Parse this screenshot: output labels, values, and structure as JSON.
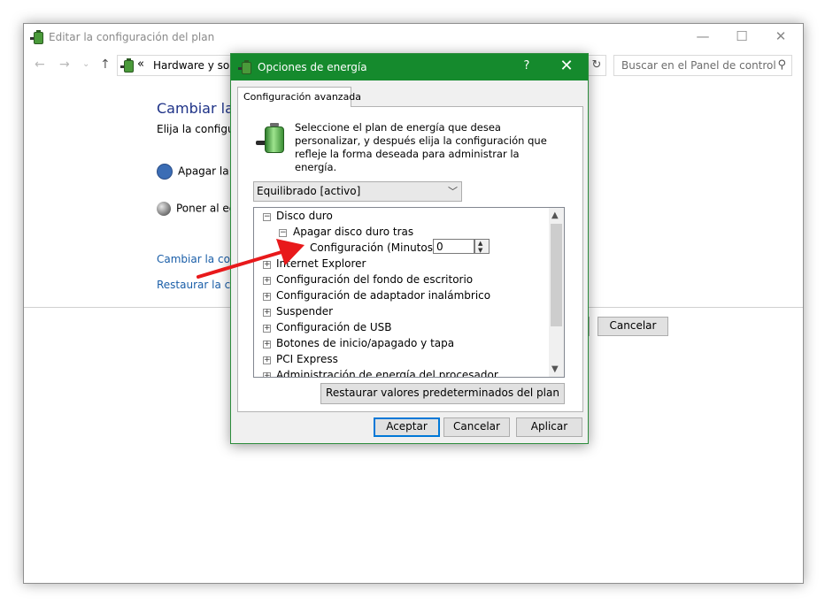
{
  "background_window": {
    "title": "Editar la configuración del plan",
    "controls": {
      "minimize": "—",
      "maximize": "☐",
      "close": "✕"
    },
    "nav": {
      "back": "←",
      "forward": "→",
      "recent": "⌄",
      "up": "↑"
    },
    "address": {
      "separator": "«",
      "path": "Hardware y sonido"
    },
    "refresh": "↻",
    "search_placeholder": "Buscar en el Panel de control",
    "heading": "Cambiar la c",
    "subtitle": "Elija la configura",
    "option_display": "Apagar la p",
    "option_sleep": "Poner al eq",
    "link_change": "Cambiar la confi",
    "link_restore": "Restaurar la con",
    "cancel_label": "Cancelar"
  },
  "dialog": {
    "title": "Opciones de energía",
    "help": "?",
    "close": "✕",
    "tab_label": "Configuración avanzada",
    "description": "Seleccione el plan de energía que desea personalizar, y después elija la configuración que refleje la forma deseada para administrar la energía.",
    "plan_selected": "Equilibrado [activo]",
    "tree": {
      "disk": "Disco duro",
      "turn_off_after": "Apagar disco duro tras",
      "setting_label": "Configuración (Minutos):",
      "setting_value": "0",
      "items": [
        "Internet Explorer",
        "Configuración del fondo de escritorio",
        "Configuración de adaptador inalámbrico",
        "Suspender",
        "Configuración de USB",
        "Botones de inicio/apagado y tapa",
        "PCI Express",
        "Administración de energía del procesador"
      ]
    },
    "restore_label": "Restaurar valores predeterminados del plan",
    "accept_label": "Aceptar",
    "cancel_label": "Cancelar",
    "apply_label": "Aplicar"
  },
  "colors": {
    "dialog_title": "#158a2d",
    "arrow": "#e8191b",
    "link": "#1a5ea8"
  }
}
